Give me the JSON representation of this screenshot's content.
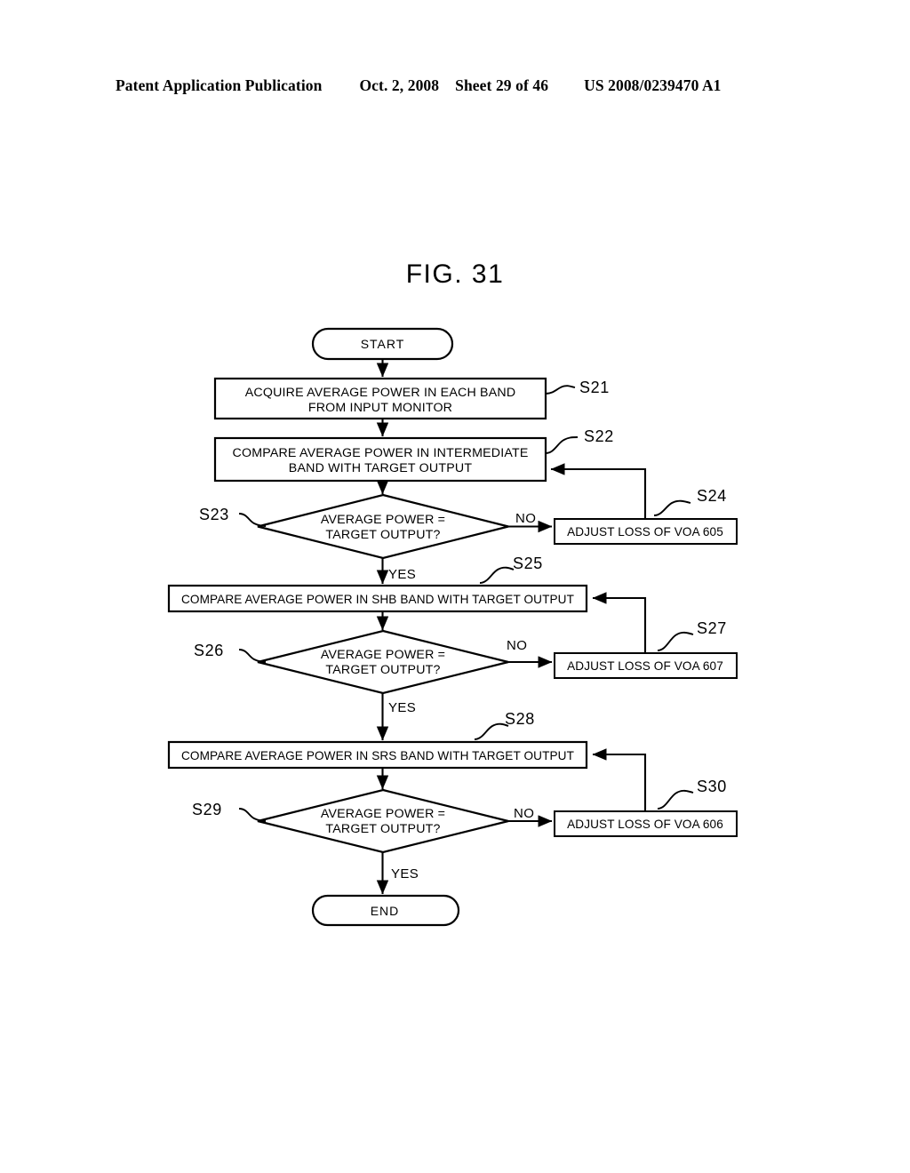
{
  "header": {
    "title": "Patent Application Publication",
    "date": "Oct. 2, 2008",
    "sheet": "Sheet 29 of 46",
    "patent_number": "US 2008/0239470 A1"
  },
  "figure": {
    "title": "FIG. 31"
  },
  "flowchart": {
    "start_label": "START",
    "end_label": "END",
    "nodes": [
      {
        "id": "S21",
        "type": "process",
        "step": "S21",
        "lines": [
          "ACQUIRE AVERAGE POWER IN EACH BAND",
          "FROM INPUT MONITOR"
        ]
      },
      {
        "id": "S22",
        "type": "process",
        "step": "S22",
        "lines": [
          "COMPARE AVERAGE POWER IN INTERMEDIATE",
          "BAND WITH TARGET OUTPUT"
        ]
      },
      {
        "id": "S23",
        "type": "decision",
        "step": "S23",
        "lines": [
          "AVERAGE POWER =",
          "TARGET OUTPUT?"
        ],
        "yes": "YES",
        "no": "NO"
      },
      {
        "id": "S24",
        "type": "process",
        "step": "S24",
        "lines": [
          "ADJUST LOSS OF VOA 605"
        ]
      },
      {
        "id": "S25",
        "type": "process",
        "step": "S25",
        "lines": [
          "COMPARE AVERAGE POWER IN SHB BAND WITH TARGET OUTPUT"
        ]
      },
      {
        "id": "S26",
        "type": "decision",
        "step": "S26",
        "lines": [
          "AVERAGE POWER =",
          "TARGET OUTPUT?"
        ],
        "yes": "YES",
        "no": "NO"
      },
      {
        "id": "S27",
        "type": "process",
        "step": "S27",
        "lines": [
          "ADJUST LOSS OF VOA 607"
        ]
      },
      {
        "id": "S28",
        "type": "process",
        "step": "S28",
        "lines": [
          "COMPARE AVERAGE POWER IN SRS BAND WITH TARGET OUTPUT"
        ]
      },
      {
        "id": "S29",
        "type": "decision",
        "step": "S29",
        "lines": [
          "AVERAGE POWER =",
          "TARGET OUTPUT?"
        ],
        "yes": "YES",
        "no": "NO"
      },
      {
        "id": "S30",
        "type": "process",
        "step": "S30",
        "lines": [
          "ADJUST LOSS OF VOA 606"
        ]
      }
    ]
  },
  "colors": {
    "ink": "#000000",
    "paper": "#ffffff"
  }
}
